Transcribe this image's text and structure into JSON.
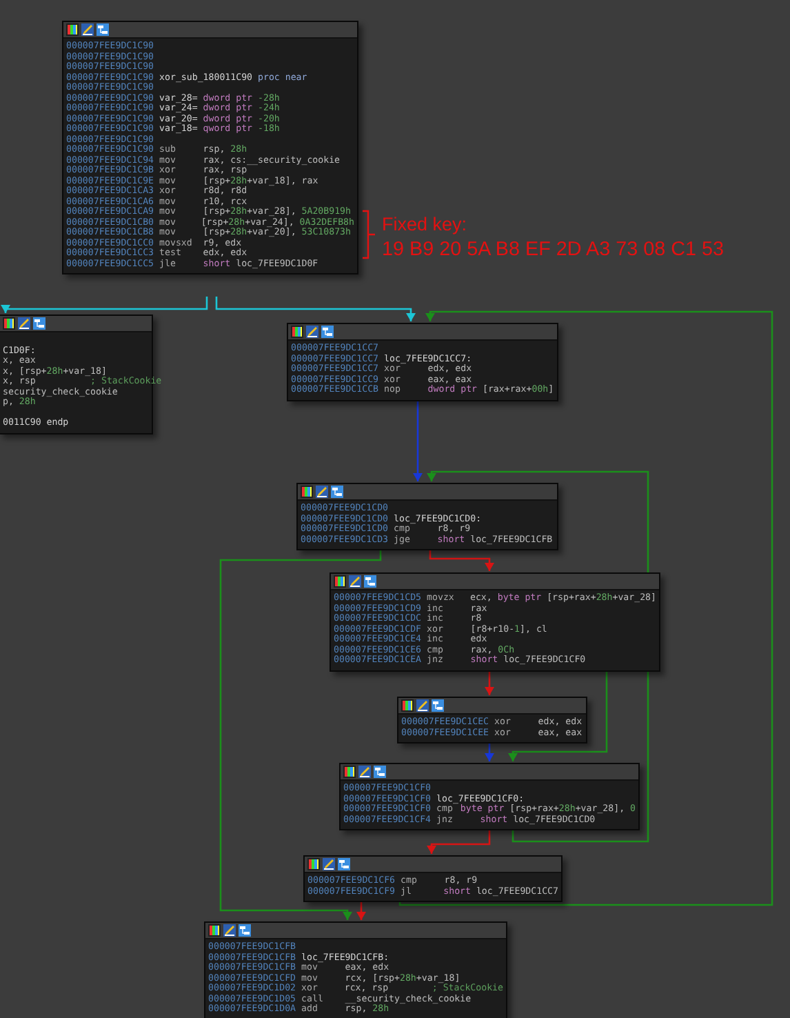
{
  "blocks": [
    {
      "lines": [
        {
          "address": "000007FEE9DC1C90"
        },
        {
          "address": "000007FEE9DC1C90"
        },
        {
          "address": "000007FEE9DC1C90"
        },
        {
          "address": "000007FEE9DC1C90",
          "tokens": [
            {
              "text": "xor_sub_180011C90 ",
              "kind": "name"
            },
            {
              "text": "proc near",
              "kind": "directive"
            }
          ]
        },
        {
          "address": "000007FEE9DC1C90"
        },
        {
          "address": "000007FEE9DC1C90",
          "tokens": [
            {
              "text": "var_28= ",
              "kind": "name"
            },
            {
              "text": "dword ptr ",
              "kind": "keyword"
            },
            {
              "text": "-28h",
              "kind": "number"
            }
          ]
        },
        {
          "address": "000007FEE9DC1C90",
          "tokens": [
            {
              "text": "var_24= ",
              "kind": "name"
            },
            {
              "text": "dword ptr ",
              "kind": "keyword"
            },
            {
              "text": "-24h",
              "kind": "number"
            }
          ]
        },
        {
          "address": "000007FEE9DC1C90",
          "tokens": [
            {
              "text": "var_20= ",
              "kind": "name"
            },
            {
              "text": "dword ptr ",
              "kind": "keyword"
            },
            {
              "text": "-20h",
              "kind": "number"
            }
          ]
        },
        {
          "address": "000007FEE9DC1C90",
          "tokens": [
            {
              "text": "var_18= ",
              "kind": "name"
            },
            {
              "text": "qword ptr ",
              "kind": "keyword"
            },
            {
              "text": "-18h",
              "kind": "number"
            }
          ]
        },
        {
          "address": "000007FEE9DC1C90"
        },
        {
          "address": "000007FEE9DC1C90",
          "mnemonic": "sub",
          "tokens": [
            {
              "text": "rsp, "
            },
            {
              "text": "28h",
              "kind": "number"
            }
          ]
        },
        {
          "address": "000007FEE9DC1C94",
          "mnemonic": "mov",
          "tokens": [
            {
              "text": "rax, cs:__security_cookie"
            }
          ]
        },
        {
          "address": "000007FEE9DC1C9B",
          "mnemonic": "xor",
          "tokens": [
            {
              "text": "rax, rsp"
            }
          ]
        },
        {
          "address": "000007FEE9DC1C9E",
          "mnemonic": "mov",
          "tokens": [
            {
              "text": "[rsp+"
            },
            {
              "text": "28h",
              "kind": "number"
            },
            {
              "text": "+var_18], rax"
            }
          ]
        },
        {
          "address": "000007FEE9DC1CA3",
          "mnemonic": "xor",
          "tokens": [
            {
              "text": "r8d, r8d"
            }
          ]
        },
        {
          "address": "000007FEE9DC1CA6",
          "mnemonic": "mov",
          "tokens": [
            {
              "text": "r10, rcx"
            }
          ]
        },
        {
          "address": "000007FEE9DC1CA9",
          "mnemonic": "mov",
          "tokens": [
            {
              "text": "[rsp+"
            },
            {
              "text": "28h",
              "kind": "number"
            },
            {
              "text": "+var_28], "
            },
            {
              "text": "5A20B919h",
              "kind": "number"
            }
          ]
        },
        {
          "address": "000007FEE9DC1CB0",
          "mnemonic": "mov",
          "tokens": [
            {
              "text": "[rsp+"
            },
            {
              "text": "28h",
              "kind": "number"
            },
            {
              "text": "+var_24], "
            },
            {
              "text": "0A32DEFB8h",
              "kind": "number"
            }
          ]
        },
        {
          "address": "000007FEE9DC1CB8",
          "mnemonic": "mov",
          "tokens": [
            {
              "text": "[rsp+"
            },
            {
              "text": "28h",
              "kind": "number"
            },
            {
              "text": "+var_20], "
            },
            {
              "text": "53C10873h",
              "kind": "number"
            }
          ]
        },
        {
          "address": "000007FEE9DC1CC0",
          "mnemonic": "movsxd",
          "tokens": [
            {
              "text": "r9, edx"
            }
          ]
        },
        {
          "address": "000007FEE9DC1CC3",
          "mnemonic": "test",
          "tokens": [
            {
              "text": "edx, edx"
            }
          ]
        },
        {
          "address": "000007FEE9DC1CC5",
          "mnemonic": "jle",
          "tokens": [
            {
              "text": "short ",
              "kind": "keyword"
            },
            {
              "text": "loc_7FEE9DC1D0F"
            }
          ]
        }
      ]
    },
    {
      "lines": [
        {
          "tokens": [
            {
              "text": "C1D0F:",
              "kind": "name"
            }
          ]
        },
        {
          "tokens": [
            {
              "text": "x, eax"
            }
          ]
        },
        {
          "tokens": [
            {
              "text": "x, [rsp+"
            },
            {
              "text": "28h",
              "kind": "number"
            },
            {
              "text": "+var_18]"
            }
          ]
        },
        {
          "tokens": [
            {
              "text": "x, rsp          "
            },
            {
              "text": "; StackCookie",
              "kind": "comment"
            }
          ]
        },
        {
          "tokens": [
            {
              "text": "security_check_cookie"
            }
          ]
        },
        {
          "tokens": [
            {
              "text": "p, "
            },
            {
              "text": "28h",
              "kind": "number"
            }
          ]
        },
        {
          "tokens": [
            {
              "text": "0011C90 endp",
              "kind": "name"
            }
          ]
        }
      ]
    },
    {
      "lines": [
        {
          "address": "000007FEE9DC1CC7"
        },
        {
          "address": "000007FEE9DC1CC7",
          "tokens": [
            {
              "text": "loc_7FEE9DC1CC7:",
              "kind": "name"
            }
          ]
        },
        {
          "address": "000007FEE9DC1CC7",
          "mnemonic": "xor",
          "tokens": [
            {
              "text": "edx, edx"
            }
          ]
        },
        {
          "address": "000007FEE9DC1CC9",
          "mnemonic": "xor",
          "tokens": [
            {
              "text": "eax, eax"
            }
          ]
        },
        {
          "address": "000007FEE9DC1CCB",
          "mnemonic": "nop",
          "tokens": [
            {
              "text": "dword ptr ",
              "kind": "keyword"
            },
            {
              "text": "[rax+rax+"
            },
            {
              "text": "00h",
              "kind": "number"
            },
            {
              "text": "]"
            }
          ]
        }
      ]
    },
    {
      "lines": [
        {
          "address": "000007FEE9DC1CD0"
        },
        {
          "address": "000007FEE9DC1CD0",
          "tokens": [
            {
              "text": "loc_7FEE9DC1CD0:",
              "kind": "name"
            }
          ]
        },
        {
          "address": "000007FEE9DC1CD0",
          "mnemonic": "cmp",
          "tokens": [
            {
              "text": "r8, r9"
            }
          ]
        },
        {
          "address": "000007FEE9DC1CD3",
          "mnemonic": "jge",
          "tokens": [
            {
              "text": "short ",
              "kind": "keyword"
            },
            {
              "text": "loc_7FEE9DC1CFB"
            }
          ]
        }
      ]
    },
    {
      "lines": [
        {
          "address": "000007FEE9DC1CD5",
          "mnemonic": "movzx",
          "tokens": [
            {
              "text": "ecx, "
            },
            {
              "text": "byte ptr ",
              "kind": "keyword"
            },
            {
              "text": "[rsp+rax+"
            },
            {
              "text": "28h",
              "kind": "number"
            },
            {
              "text": "+var_28]"
            }
          ]
        },
        {
          "address": "000007FEE9DC1CD9",
          "mnemonic": "inc",
          "tokens": [
            {
              "text": "rax"
            }
          ]
        },
        {
          "address": "000007FEE9DC1CDC",
          "mnemonic": "inc",
          "tokens": [
            {
              "text": "r8"
            }
          ]
        },
        {
          "address": "000007FEE9DC1CDF",
          "mnemonic": "xor",
          "tokens": [
            {
              "text": "[r8+r10-"
            },
            {
              "text": "1",
              "kind": "number"
            },
            {
              "text": "], cl"
            }
          ]
        },
        {
          "address": "000007FEE9DC1CE4",
          "mnemonic": "inc",
          "tokens": [
            {
              "text": "edx"
            }
          ]
        },
        {
          "address": "000007FEE9DC1CE6",
          "mnemonic": "cmp",
          "tokens": [
            {
              "text": "rax, "
            },
            {
              "text": "0Ch",
              "kind": "number"
            }
          ]
        },
        {
          "address": "000007FEE9DC1CEA",
          "mnemonic": "jnz",
          "tokens": [
            {
              "text": "short ",
              "kind": "keyword"
            },
            {
              "text": "loc_7FEE9DC1CF0"
            }
          ]
        }
      ]
    },
    {
      "lines": [
        {
          "address": "000007FEE9DC1CEC",
          "mnemonic": "xor",
          "tokens": [
            {
              "text": "edx, edx"
            }
          ]
        },
        {
          "address": "000007FEE9DC1CEE",
          "mnemonic": "xor",
          "tokens": [
            {
              "text": "eax, eax"
            }
          ]
        }
      ]
    },
    {
      "lines": [
        {
          "address": "000007FEE9DC1CF0"
        },
        {
          "address": "000007FEE9DC1CF0",
          "tokens": [
            {
              "text": "loc_7FEE9DC1CF0:",
              "kind": "name"
            }
          ]
        },
        {
          "address": "000007FEE9DC1CF0",
          "mnemonic": "cmp",
          "tokens": [
            {
              "text": "byte ptr ",
              "kind": "keyword"
            },
            {
              "text": "[rsp+rax+"
            },
            {
              "text": "28h",
              "kind": "number"
            },
            {
              "text": "+var_28], "
            },
            {
              "text": "0",
              "kind": "number"
            }
          ]
        },
        {
          "address": "000007FEE9DC1CF4",
          "mnemonic": "jnz",
          "tokens": [
            {
              "text": "short ",
              "kind": "keyword"
            },
            {
              "text": "loc_7FEE9DC1CD0"
            }
          ]
        }
      ]
    },
    {
      "lines": [
        {
          "address": "000007FEE9DC1CF6",
          "mnemonic": "cmp",
          "tokens": [
            {
              "text": "r8, r9"
            }
          ]
        },
        {
          "address": "000007FEE9DC1CF9",
          "mnemonic": "jl",
          "tokens": [
            {
              "text": "short ",
              "kind": "keyword"
            },
            {
              "text": "loc_7FEE9DC1CC7"
            }
          ]
        }
      ]
    },
    {
      "lines": [
        {
          "address": "000007FEE9DC1CFB"
        },
        {
          "address": "000007FEE9DC1CFB",
          "tokens": [
            {
              "text": "loc_7FEE9DC1CFB:",
              "kind": "name"
            }
          ]
        },
        {
          "address": "000007FEE9DC1CFB",
          "mnemonic": "mov",
          "tokens": [
            {
              "text": "eax, edx"
            }
          ]
        },
        {
          "address": "000007FEE9DC1CFD",
          "mnemonic": "mov",
          "tokens": [
            {
              "text": "rcx, [rsp+"
            },
            {
              "text": "28h",
              "kind": "number"
            },
            {
              "text": "+var_18]"
            }
          ]
        },
        {
          "address": "000007FEE9DC1D02",
          "mnemonic": "xor",
          "tokens": [
            {
              "text": "rcx, rsp        "
            },
            {
              "text": "; StackCookie",
              "kind": "comment"
            }
          ]
        },
        {
          "address": "000007FEE9DC1D05",
          "mnemonic": "call",
          "tokens": [
            {
              "text": "__security_check_cookie"
            }
          ]
        },
        {
          "address": "000007FEE9DC1D0A",
          "mnemonic": "add",
          "tokens": [
            {
              "text": "rsp, "
            },
            {
              "text": "28h",
              "kind": "number"
            }
          ]
        }
      ]
    }
  ],
  "edges": [
    {
      "kind": "highlight"
    },
    {
      "kind": "highlight"
    },
    {
      "kind": "jump"
    },
    {
      "kind": "false"
    },
    {
      "kind": "true"
    },
    {
      "kind": "false"
    },
    {
      "kind": "true"
    },
    {
      "kind": "jump"
    },
    {
      "kind": "false"
    },
    {
      "kind": "true"
    },
    {
      "kind": "false"
    },
    {
      "kind": "true"
    }
  ],
  "annotation": {
    "title": "Fixed key:",
    "bytes": "19 B9 20 5A B8 EF 2D A3 73 08 C1 53"
  }
}
